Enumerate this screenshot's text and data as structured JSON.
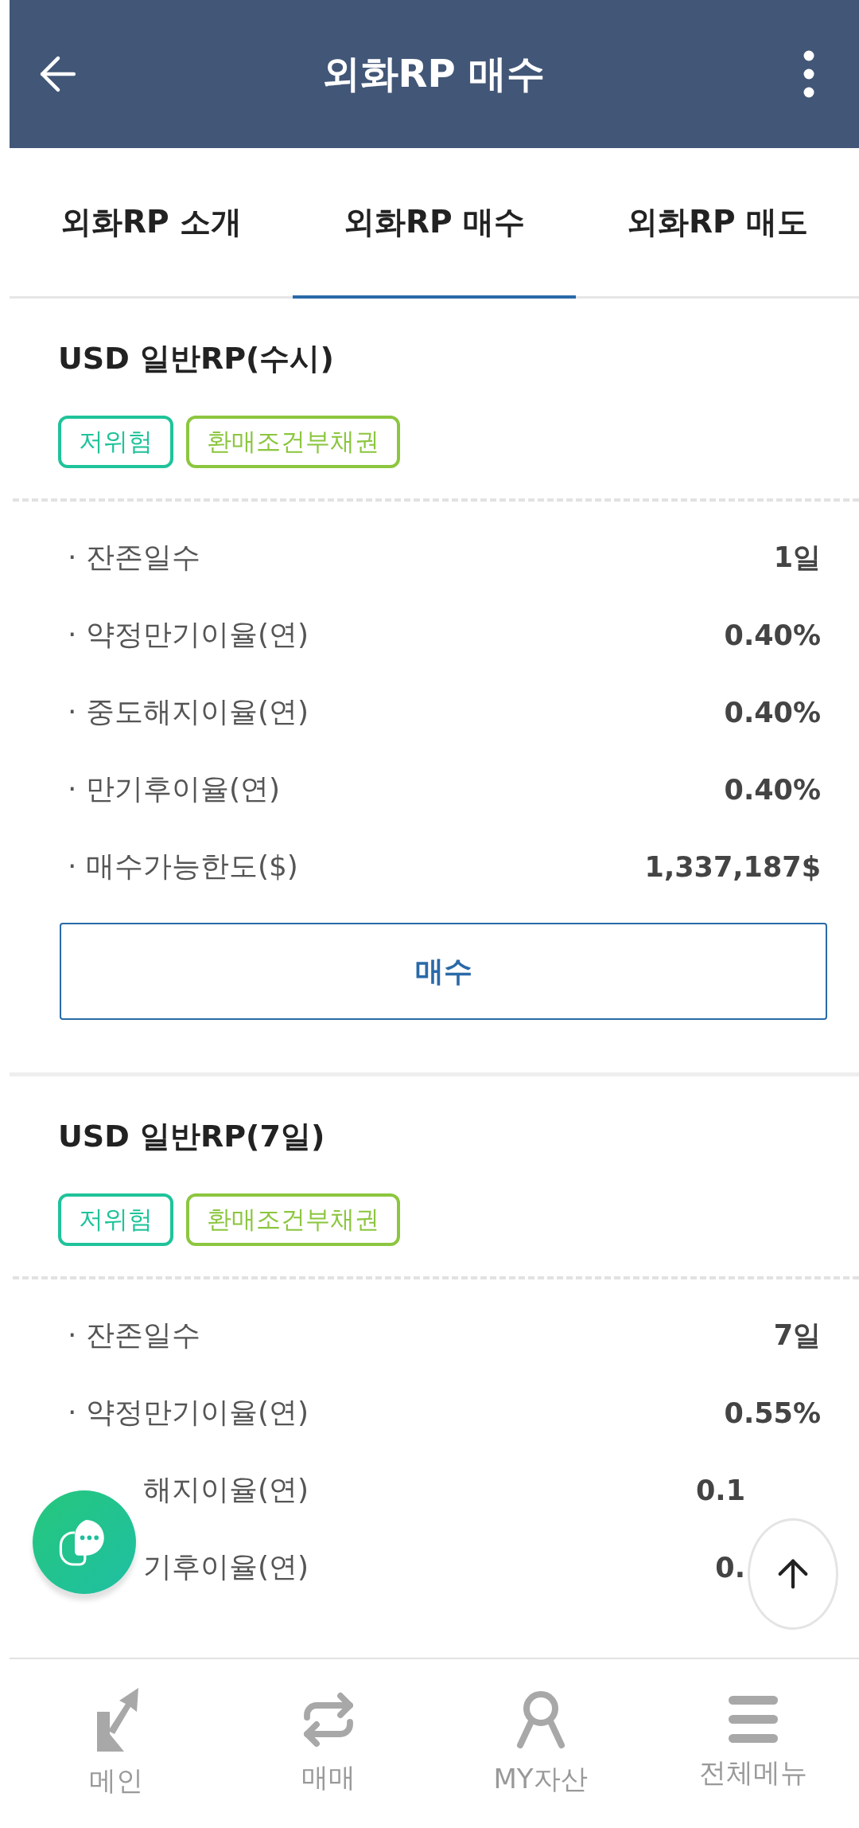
{
  "header": {
    "title": "외화RP 매수"
  },
  "tabs": [
    {
      "label": "외화RP 소개",
      "selected": false
    },
    {
      "label": "외화RP 매수",
      "selected": true
    },
    {
      "label": "외화RP 매도",
      "selected": false
    }
  ],
  "products": [
    {
      "title": "USD 일반RP(수시)",
      "tags": [
        {
          "label": "저위험",
          "color": "#1fc39a"
        },
        {
          "label": "환매조건부채권",
          "color": "#8cc63f"
        }
      ],
      "details": [
        {
          "label": "· 잔존일수",
          "value": "1일"
        },
        {
          "label": "· 약정만기이율(연)",
          "value": "0.40%"
        },
        {
          "label": "· 중도해지이율(연)",
          "value": "0.40%"
        },
        {
          "label": "· 만기후이율(연)",
          "value": "0.40%"
        },
        {
          "label": "· 매수가능한도($)",
          "value": "1,337,187$"
        }
      ],
      "button": "매수"
    },
    {
      "title": "USD 일반RP(7일)",
      "tags": [
        {
          "label": "저위험",
          "color": "#1fc39a"
        },
        {
          "label": "환매조건부채권",
          "color": "#8cc63f"
        }
      ],
      "details": [
        {
          "label": "· 잔존일수",
          "value": "7일"
        },
        {
          "label": "· 약정만기이율(연)",
          "value": "0.55%"
        },
        {
          "label": "해지이율(연)",
          "value": "0.1",
          "cut": true
        },
        {
          "label": "기후이율(연)",
          "value": "0.",
          "cut": true
        }
      ]
    }
  ],
  "bottom_nav": [
    {
      "label": "메인"
    },
    {
      "label": "매매"
    },
    {
      "label": "MY자산"
    },
    {
      "label": "전체메뉴"
    }
  ]
}
